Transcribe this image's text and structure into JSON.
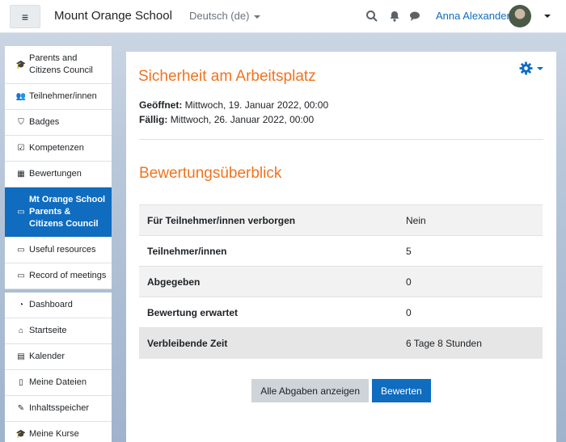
{
  "navbar": {
    "site_name": "Mount Orange School",
    "language": "Deutsch (de)",
    "user_name": "Anna Alexander",
    "icons": [
      "search-icon",
      "bell-icon",
      "chat-icon"
    ]
  },
  "sidebar": {
    "groups": [
      [
        {
          "label": "Parents and Citizens Council",
          "icon": "graduation-cap-icon"
        },
        {
          "label": "Teilnehmer/innen",
          "icon": "users-icon"
        },
        {
          "label": "Badges",
          "icon": "shield-icon"
        },
        {
          "label": "Kompetenzen",
          "icon": "checkbox-icon"
        },
        {
          "label": "Bewertungen",
          "icon": "table-icon"
        },
        {
          "label": "Mt Orange School Parents & Citizens Council",
          "icon": "folder-icon",
          "active": true
        },
        {
          "label": "Useful resources",
          "icon": "folder-icon"
        },
        {
          "label": "Record of meetings",
          "icon": "folder-icon"
        }
      ],
      [
        {
          "label": "Dashboard",
          "icon": "dashboard-icon"
        },
        {
          "label": "Startseite",
          "icon": "home-icon"
        },
        {
          "label": "Kalender",
          "icon": "calendar-icon"
        },
        {
          "label": "Meine Dateien",
          "icon": "file-icon"
        },
        {
          "label": "Inhaltsspeicher",
          "icon": "paint-brush-icon"
        },
        {
          "label": "Meine Kurse",
          "icon": "graduation-cap-icon"
        }
      ]
    ]
  },
  "main": {
    "title": "Sicherheit am Arbeitsplatz",
    "opened_label": "Geöffnet:",
    "opened_value": "Mittwoch, 19. Januar 2022, 00:00",
    "due_label": "Fällig:",
    "due_value": "Mittwoch, 26. Januar 2022, 00:00",
    "section_title": "Bewertungsüberblick",
    "summary": [
      {
        "label": "Für Teilnehmer/innen verborgen",
        "value": "Nein"
      },
      {
        "label": "Teilnehmer/innen",
        "value": "5"
      },
      {
        "label": "Abgegeben",
        "value": "0"
      },
      {
        "label": "Bewertung erwartet",
        "value": "0"
      },
      {
        "label": "Verbleibende Zeit",
        "value": "6 Tage 8 Stunden"
      }
    ],
    "buttons": {
      "view_all": "Alle Abgaben anzeigen",
      "grade": "Bewerten"
    }
  },
  "colors": {
    "accent": "#f0731f",
    "primary": "#0f6cbf"
  }
}
